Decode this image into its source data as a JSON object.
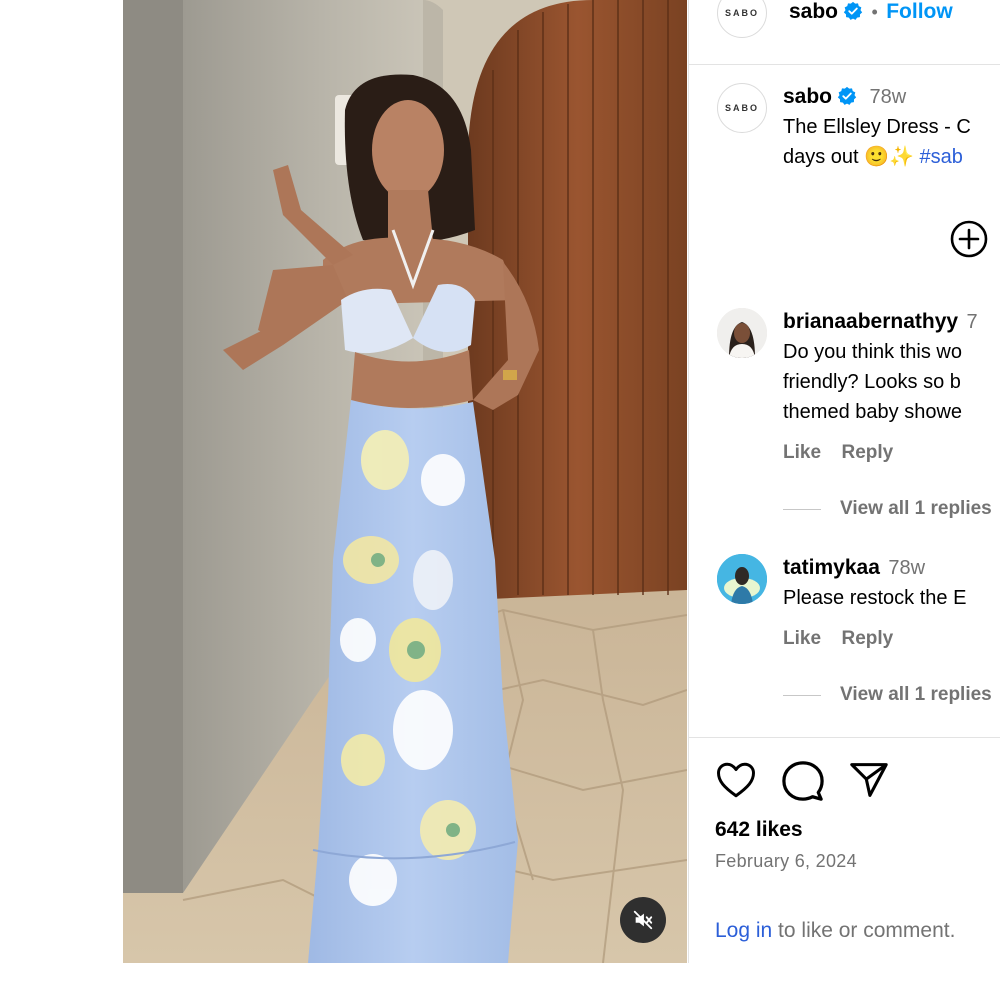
{
  "post": {
    "account": {
      "username": "sabo",
      "avatar_text": "SABO",
      "verified": true,
      "separator": "•",
      "follow_label": "Follow"
    },
    "caption": {
      "username": "sabo",
      "time": "78w",
      "line1": "The Ellsley Dress - C",
      "line2_text": "days out 🙂✨",
      "line2_hashtag": "#sab"
    },
    "comments": [
      {
        "username": "brianaabernathyy",
        "time": "7",
        "lines": [
          "Do you think this wo",
          "friendly? Looks so b",
          "themed baby showe"
        ],
        "like_label": "Like",
        "reply_label": "Reply",
        "view_replies": "View all 1 replies"
      },
      {
        "username": "tatimykaa",
        "time": "78w",
        "lines": [
          "Please restock the E"
        ],
        "like_label": "Like",
        "reply_label": "Reply",
        "view_replies": "View all 1 replies"
      }
    ],
    "likes": "642 likes",
    "date": "February 6, 2024",
    "login": {
      "link": "Log in",
      "rest": " to like or comment."
    }
  },
  "icons": {
    "load_more": "plus-circle-icon",
    "like": "heart-icon",
    "comment": "comment-icon",
    "share": "paper-plane-icon",
    "mute": "speaker-muted-icon",
    "verified": "verified-badge-icon"
  },
  "colors": {
    "link_blue": "#0095f6",
    "verified_blue": "#0095f6",
    "text_muted": "#737373",
    "dress_blue": "#a9c3ea",
    "door_wood": "#8a4a26"
  }
}
